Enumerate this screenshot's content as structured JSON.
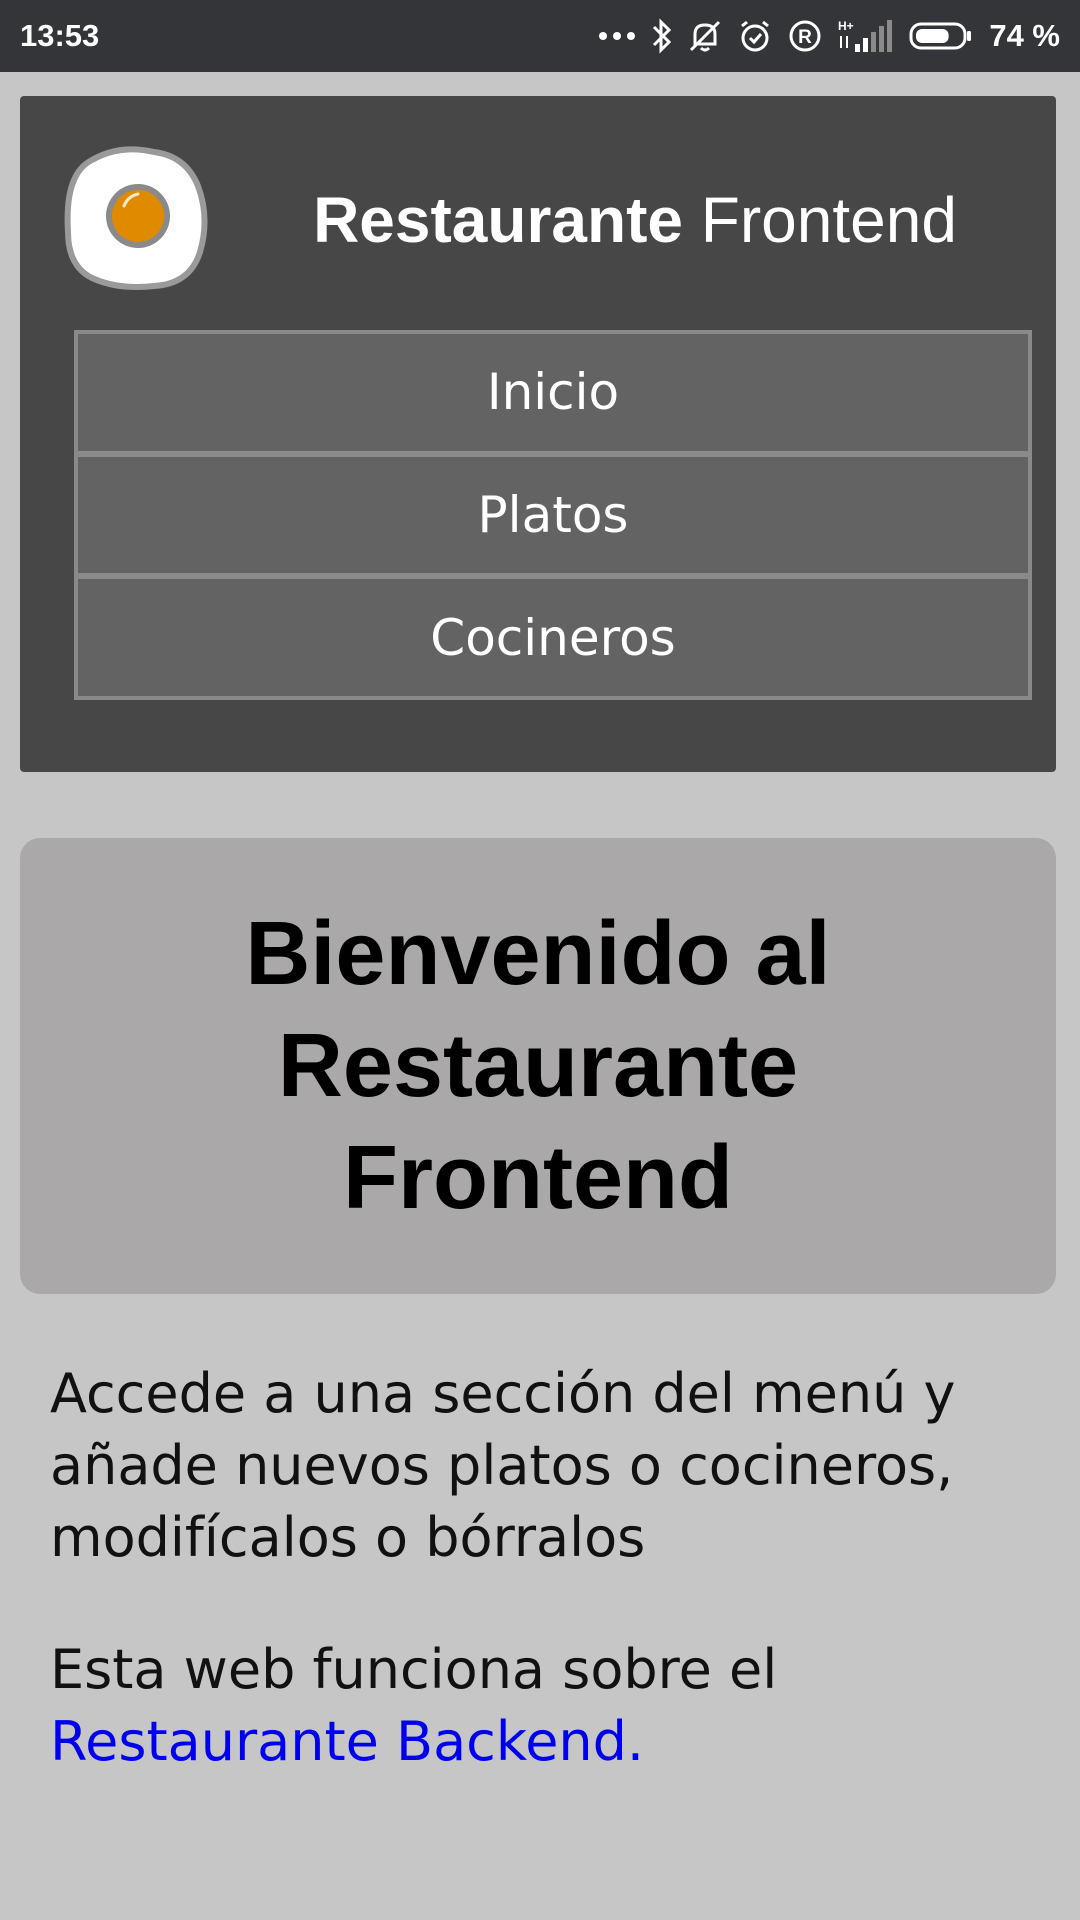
{
  "status_bar": {
    "time": "13:53",
    "battery_percent": "74 %",
    "battery_level": 0.74,
    "network_type": "H+",
    "icons": [
      "more-dots-icon",
      "bluetooth-icon",
      "silent-icon",
      "alarm-icon",
      "registered-icon",
      "signal-icon",
      "battery-icon"
    ]
  },
  "header": {
    "logo_icon": "fried-egg-icon",
    "brand_bold": "Restaurante",
    "brand_regular": "Frontend",
    "nav": [
      {
        "label": "Inicio"
      },
      {
        "label": "Platos"
      },
      {
        "label": "Cocineros"
      }
    ]
  },
  "welcome": {
    "title": "Bienvenido al Restaurante Frontend"
  },
  "content": {
    "intro": "Accede a una sección del menú y añade nuevos platos o cocineros, modifícalos o bórralos",
    "backend_prefix": "Esta web funciona sobre el",
    "backend_link": "Restaurante Backend."
  },
  "colors": {
    "page_background": "#c6c6c6",
    "header_background": "#474747",
    "nav_item_background": "#636363",
    "welcome_background": "#aaa8a9",
    "link": "#0000ee",
    "egg_yolk": "#e08a00"
  }
}
